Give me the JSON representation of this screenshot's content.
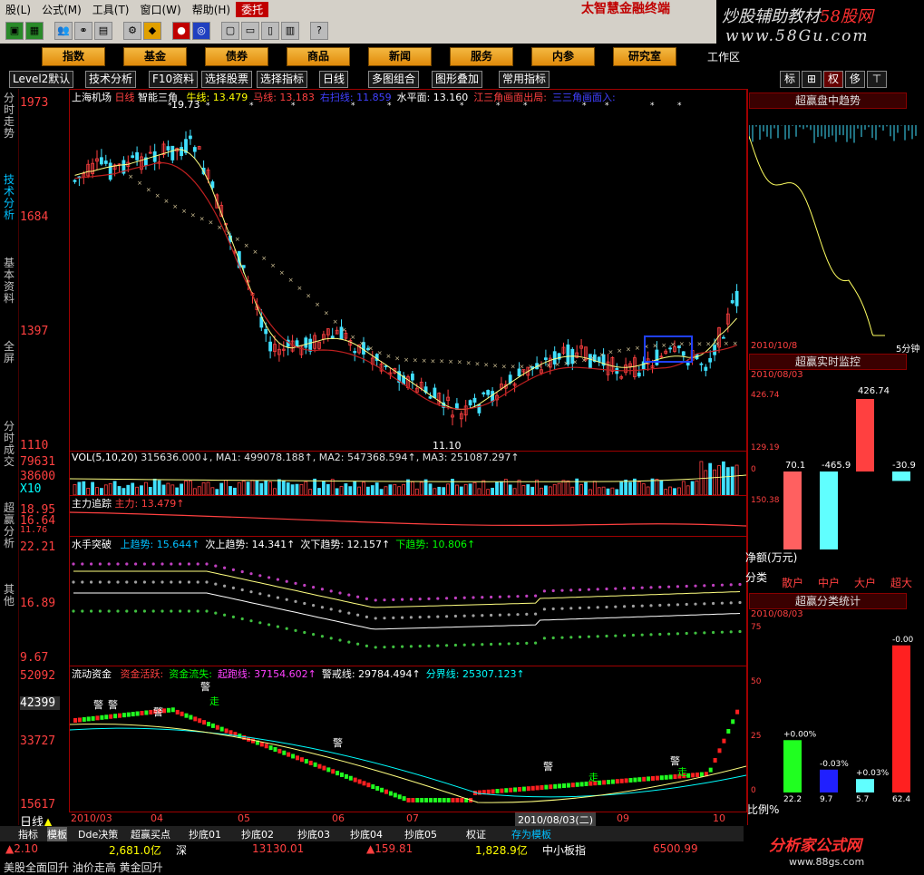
{
  "menu": {
    "items": [
      "股(L)",
      "公式(M)",
      "工具(T)",
      "窗口(W)",
      "帮助(H)"
    ],
    "active": "委托",
    "brand": "太智慧金融终端"
  },
  "promo": {
    "line1a": "炒股辅助教材",
    "line1b": "58股网",
    "line2": "www.58Gu.com"
  },
  "nav": {
    "items": [
      "指数",
      "基金",
      "债券",
      "商品",
      "新闻",
      "服务",
      "内参",
      "研究室"
    ],
    "workarea": "工作区"
  },
  "subtoolbar": {
    "items": [
      "Level2默认",
      "技术分析",
      "F10资料",
      "选择股票",
      "选择指标",
      "日线",
      "多图组合",
      "图形叠加",
      "常用指标"
    ],
    "right_buttons": [
      "标",
      "⊞",
      "权",
      "侈",
      "⊤"
    ]
  },
  "left_tabs": [
    "分时走势",
    "技术分析",
    "基本资料",
    "全屏",
    "分时成交",
    "超赢分析",
    "其他"
  ],
  "price_axis": [
    "1973",
    "1684",
    "1397",
    "1110"
  ],
  "main_panel": {
    "name": "上海机场",
    "period": "日线",
    "indicator": "智能三角",
    "labels": [
      {
        "k": "牛线:",
        "v": "13.479",
        "color": "#ffff00"
      },
      {
        "k": "马线:",
        "v": "13.183",
        "color": "#ff4040"
      },
      {
        "k": "右扫线:",
        "v": "11.859",
        "color": "#4040ff"
      },
      {
        "k": "水平面:",
        "v": "13.160",
        "color": "#ffffff"
      },
      {
        "k": "江三角画面出局:",
        "v": "",
        "color": "#ff4040"
      },
      {
        "k": "三三角画面入:",
        "v": "",
        "color": "#4040ff"
      }
    ],
    "peak_label": "19.73",
    "low_label": "11.10"
  },
  "vol_panel": {
    "title": "VOL(5,10,20)",
    "values": "315636.000↓, MA1: 499078.188↑, MA2: 547368.594↑, MA3: 251087.297↑",
    "axis": [
      "79631",
      "38600",
      "X10"
    ]
  },
  "main_force": {
    "title": "主力追踪",
    "label": "主力:",
    "value": "13.479↑",
    "axis": [
      "18.95",
      "16.64",
      "11.76"
    ]
  },
  "water_panel": {
    "title": "水手突破",
    "labels": [
      {
        "k": "上趋势:",
        "v": "15.644↑",
        "color": "#00c0ff"
      },
      {
        "k": "次上趋势:",
        "v": "14.341↑",
        "color": "#ffffff"
      },
      {
        "k": "次下趋势:",
        "v": "12.157↑",
        "color": "#ffffff"
      },
      {
        "k": "下趋势:",
        "v": "10.806↑",
        "color": "#00ff00"
      }
    ],
    "axis": [
      "22.21",
      "16.89",
      "9.67"
    ]
  },
  "flow_panel": {
    "title": "流动资金",
    "labels": [
      {
        "k": "资金活跃:",
        "v": "",
        "color": "#ff4040"
      },
      {
        "k": "资金流失:",
        "v": "",
        "color": "#00ff00"
      },
      {
        "k": "起跑线:",
        "v": "37154.602↑",
        "color": "#ff40ff"
      },
      {
        "k": "警戒线:",
        "v": "29784.494↑",
        "color": "#ffffff"
      },
      {
        "k": "分界线:",
        "v": "25307.123↑",
        "color": "#00ffff"
      }
    ],
    "axis": [
      "52092",
      "42399",
      "33727",
      "15617"
    ],
    "marks": [
      "警",
      "警",
      "警",
      "警",
      "警",
      "警",
      "警",
      "走",
      "走",
      "走"
    ]
  },
  "time_axis": [
    "2010/03",
    "04",
    "05",
    "06",
    "07",
    "2010/08/03(二)",
    "09",
    "10"
  ],
  "right": {
    "trend_title": "超赢盘中趋势",
    "trend_time": "5分钟",
    "trend_date": "2010/10/8",
    "monitor_title": "超赢实时监控",
    "monitor_date": "2010/08/03",
    "monitor_axis": [
      "426.74",
      "129.19",
      "0",
      "150.38"
    ],
    "monitor_values": [
      "70.1",
      "-465.9",
      "426.74",
      "-30.9"
    ],
    "monitor_unit": "净额(万元)",
    "categories": [
      "散户",
      "中户",
      "大户",
      "超大"
    ],
    "class_label": "分类",
    "stat_title": "超赢分类统计",
    "stat_date": "2010/08/03",
    "stat_axis": [
      "75",
      "50",
      "25",
      "0"
    ],
    "stat_labels": [
      "+0.00%",
      "-0.03%",
      "+0.03%",
      "-0.00"
    ],
    "stat_bottom": [
      "22.2",
      "9.7",
      "5.7",
      "62.4"
    ],
    "stat_ratio": "比例%"
  },
  "bottom_tabs": [
    "指标",
    "模板",
    "Dde决策",
    "超赢买点",
    "抄底01",
    "抄底02",
    "抄底03",
    "抄底04",
    "抄底05",
    "权证",
    "存为模板"
  ],
  "period_label": "日线",
  "status": {
    "a": "▲2.10",
    "b": "2,681.0亿",
    "c": "深",
    "d": "13130.01",
    "e": "▲159.81",
    "f": "1,828.9亿",
    "g": "中小板指",
    "h": "6500.99"
  },
  "ticker": "美股全面回升 油价走高 黄金回升",
  "logo2": {
    "a": "分析家公式网",
    "b": "www.88gs.com"
  }
}
